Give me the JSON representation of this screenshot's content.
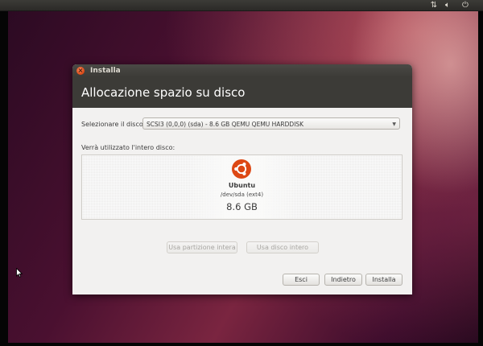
{
  "tray": {
    "network_icon": "network-arrows-icon",
    "volume_icon": "speaker-icon",
    "power_icon": "power-icon"
  },
  "window": {
    "title": "Installa",
    "close_glyph": "×"
  },
  "page": {
    "title": "Allocazione spazio su disco"
  },
  "disk_selector": {
    "label": "Selezionare il disco:",
    "value": "SCSI3 (0,0,0) (sda) - 8.6 GB QEMU QEMU HARDDISK"
  },
  "partition_area": {
    "label": "Verrà utilizzato l'intero disco:",
    "os_name": "Ubuntu",
    "device": "/dev/sda (ext4)",
    "size": "8.6 GB",
    "logo_color": "#dd4814"
  },
  "actions": {
    "use_partition": "Usa partizione intera",
    "use_disk": "Usa disco intero",
    "quit": "Esci",
    "back": "Indietro",
    "install": "Installa"
  },
  "colors": {
    "accent": "#dd4814",
    "header_bg": "#3c3b37"
  }
}
